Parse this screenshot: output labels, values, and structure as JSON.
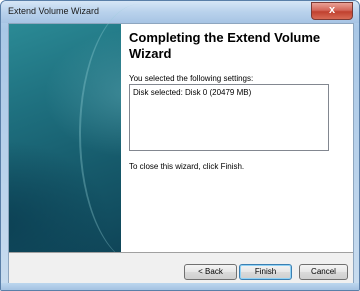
{
  "window": {
    "title": "Extend Volume Wizard",
    "close_glyph": "x"
  },
  "wizard": {
    "heading": "Completing the Extend Volume Wizard",
    "intro": "You selected the following settings:",
    "settings": [
      "Disk selected: Disk 0 (20479 MB)"
    ],
    "close_note": "To close this wizard, click Finish."
  },
  "buttons": {
    "back": "< Back",
    "finish": "Finish",
    "cancel": "Cancel"
  },
  "icons": {
    "close": "close-icon"
  }
}
